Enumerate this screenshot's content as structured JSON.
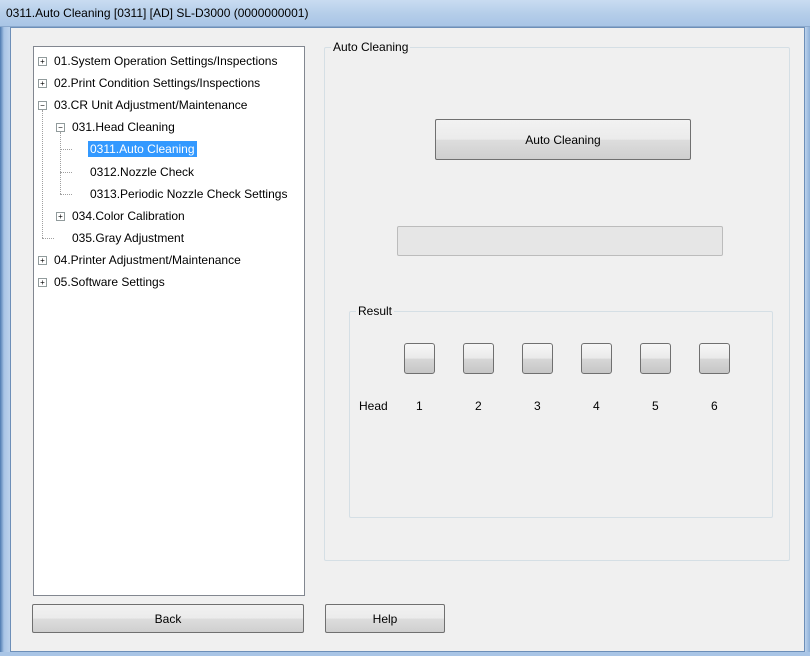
{
  "window": {
    "title": "0311.Auto Cleaning  [0311]  [AD]  SL-D3000  (0000000001)"
  },
  "tree": {
    "items": [
      {
        "label": "01.System Operation Settings/Inspections",
        "level": 0,
        "expander": "+"
      },
      {
        "label": "02.Print Condition Settings/Inspections",
        "level": 0,
        "expander": "+"
      },
      {
        "label": "03.CR Unit Adjustment/Maintenance",
        "level": 0,
        "expander": "-"
      },
      {
        "label": "031.Head Cleaning",
        "level": 1,
        "expander": "-"
      },
      {
        "label": "0311.Auto Cleaning",
        "level": 2,
        "expander": "",
        "selected": true
      },
      {
        "label": "0312.Nozzle Check",
        "level": 2,
        "expander": ""
      },
      {
        "label": "0313.Periodic Nozzle Check Settings",
        "level": 2,
        "expander": ""
      },
      {
        "label": "034.Color Calibration",
        "level": 1,
        "expander": "+"
      },
      {
        "label": "035.Gray Adjustment",
        "level": 1,
        "expander": ""
      },
      {
        "label": "04.Printer Adjustment/Maintenance",
        "level": 0,
        "expander": "+"
      },
      {
        "label": "05.Software Settings",
        "level": 0,
        "expander": "+"
      }
    ]
  },
  "panel": {
    "group_label": "Auto Cleaning",
    "action_button": "Auto Cleaning",
    "progress_value": 0,
    "result": {
      "group_label": "Result",
      "head_label": "Head",
      "heads": [
        "1",
        "2",
        "3",
        "4",
        "5",
        "6"
      ]
    }
  },
  "footer": {
    "back_label": "Back",
    "help_label": "Help"
  }
}
